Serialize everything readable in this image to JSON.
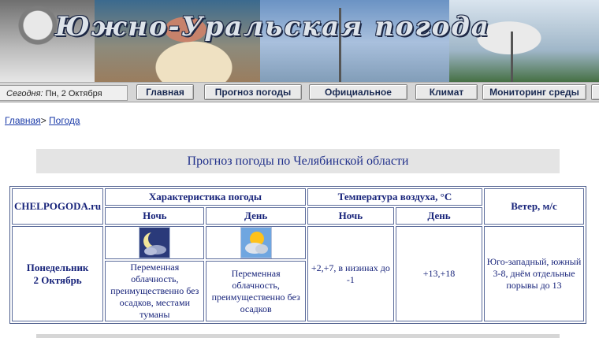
{
  "banner": {
    "title": "Южно-Уральская погода"
  },
  "nav": {
    "today_label": "Сегодня:",
    "today_value": "Пн, 2 Октября",
    "items": [
      {
        "label": "Главная"
      },
      {
        "label": "Прогноз погоды"
      },
      {
        "label": "Официальное"
      },
      {
        "label": "Климат"
      },
      {
        "label": "Мониторинг среды"
      }
    ]
  },
  "breadcrumb": {
    "home": "Главная",
    "separator": ">",
    "current": "Погода"
  },
  "page_title": "Прогноз погоды по Челябинской области",
  "table": {
    "source": "CHELPOGODA.ru",
    "headers": {
      "characteristics": "Характеристика погоды",
      "temperature": "Температура воздуха, °С",
      "wind": "Ветер, м/с",
      "night": "Ночь",
      "day": "День"
    },
    "row": {
      "day_name": "Понедельник",
      "date": "2 Октябрь",
      "night_icon": "moon-cloud-icon",
      "day_icon": "sun-cloud-icon",
      "night_desc": "Переменная облачность, преимущественно без осадков, местами туманы",
      "day_desc": "Переменная облачность, преимущественно без осадков",
      "temp_night": "+2,+7, в низинах до -1",
      "temp_day": "+13,+18",
      "wind": "Юго-западный, южный 3-8, днём отдельные порывы до 13"
    }
  }
}
